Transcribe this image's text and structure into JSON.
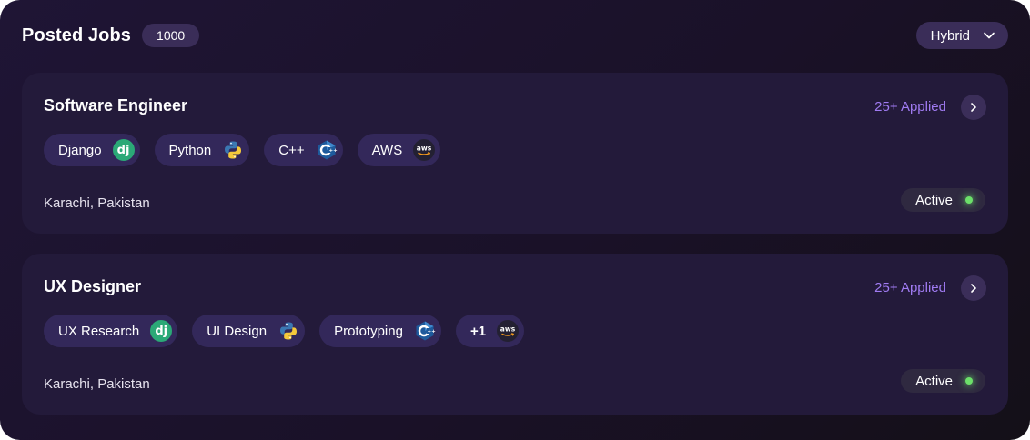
{
  "header": {
    "title": "Posted Jobs",
    "count": "1000",
    "filter_value": "Hybrid"
  },
  "jobs": [
    {
      "title": "Software Engineer",
      "applied": "25+ Applied",
      "tags": [
        {
          "label": "Django",
          "icon": "django-icon"
        },
        {
          "label": "Python",
          "icon": "python-icon"
        },
        {
          "label": "C++",
          "icon": "cpp-icon"
        },
        {
          "label": "AWS",
          "icon": "aws-icon"
        }
      ],
      "location": "Karachi, Pakistan",
      "status": "Active"
    },
    {
      "title": "UX Designer",
      "applied": "25+ Applied",
      "tags": [
        {
          "label": "UX Research",
          "icon": "django-icon"
        },
        {
          "label": "UI Design",
          "icon": "python-icon"
        },
        {
          "label": "Prototyping",
          "icon": "cpp-icon"
        },
        {
          "label": "+1",
          "icon": "aws-icon"
        }
      ],
      "location": "Karachi, Pakistan",
      "status": "Active"
    }
  ],
  "colors": {
    "accent": "#a07bf2",
    "status_active": "#6ce06a",
    "card_bg": "#231a3a",
    "chip_bg": "#33285a"
  }
}
